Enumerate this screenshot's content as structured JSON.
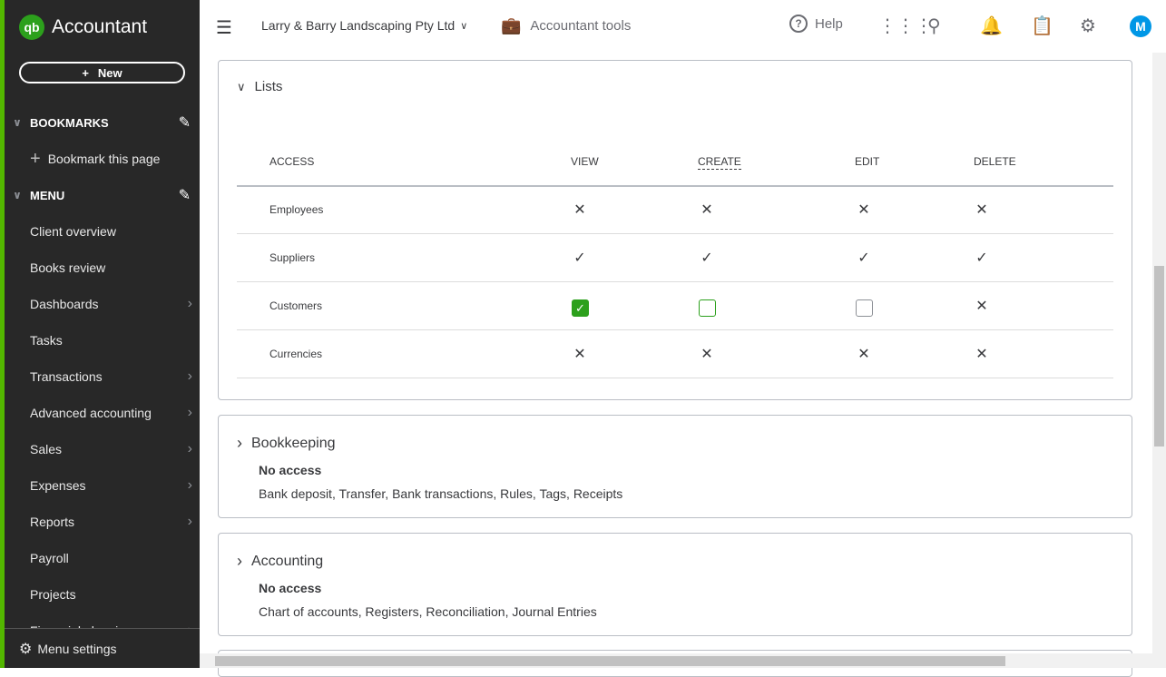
{
  "sidebar": {
    "logo": "qb",
    "product": "Accountant",
    "new_label": "New",
    "bookmarks_label": "BOOKMARKS",
    "bookmark_page": "Bookmark this page",
    "menu_label": "MENU",
    "items": [
      {
        "label": "Client overview",
        "arrow": false
      },
      {
        "label": "Books review",
        "arrow": false
      },
      {
        "label": "Dashboards",
        "arrow": true
      },
      {
        "label": "Tasks",
        "arrow": false
      },
      {
        "label": "Transactions",
        "arrow": true
      },
      {
        "label": "Advanced accounting",
        "arrow": true
      },
      {
        "label": "Sales",
        "arrow": true
      },
      {
        "label": "Expenses",
        "arrow": true
      },
      {
        "label": "Reports",
        "arrow": true
      },
      {
        "label": "Payroll",
        "arrow": false
      },
      {
        "label": "Projects",
        "arrow": false
      },
      {
        "label": "Financial planning",
        "arrow": true
      }
    ],
    "menu_settings": "Menu settings",
    "accent": "#53b700"
  },
  "topbar": {
    "company": "Larry & Barry Landscaping Pty Ltd",
    "accountant_tools": "Accountant tools",
    "help": "Help",
    "avatar": "M"
  },
  "lists": {
    "title": "Lists",
    "columns": [
      "ACCESS",
      "VIEW",
      "CREATE",
      "EDIT",
      "DELETE"
    ],
    "rows": [
      {
        "name": "Employees",
        "cells": [
          "x",
          "x",
          "x",
          "x"
        ]
      },
      {
        "name": "Suppliers",
        "cells": [
          "check",
          "check",
          "check",
          "check"
        ]
      },
      {
        "name": "Customers",
        "cells": [
          "checkbox-checked",
          "checkbox-unchecked-focused",
          "checkbox-unchecked",
          "x"
        ]
      },
      {
        "name": "Currencies",
        "cells": [
          "x",
          "x",
          "x",
          "x"
        ]
      }
    ]
  },
  "bookkeeping": {
    "title": "Bookkeeping",
    "access": "No access",
    "desc": "Bank deposit, Transfer, Bank transactions, Rules, Tags, Receipts"
  },
  "accounting": {
    "title": "Accounting",
    "access": "No access",
    "desc": "Chart of accounts, Registers, Reconciliation, Journal Entries"
  }
}
